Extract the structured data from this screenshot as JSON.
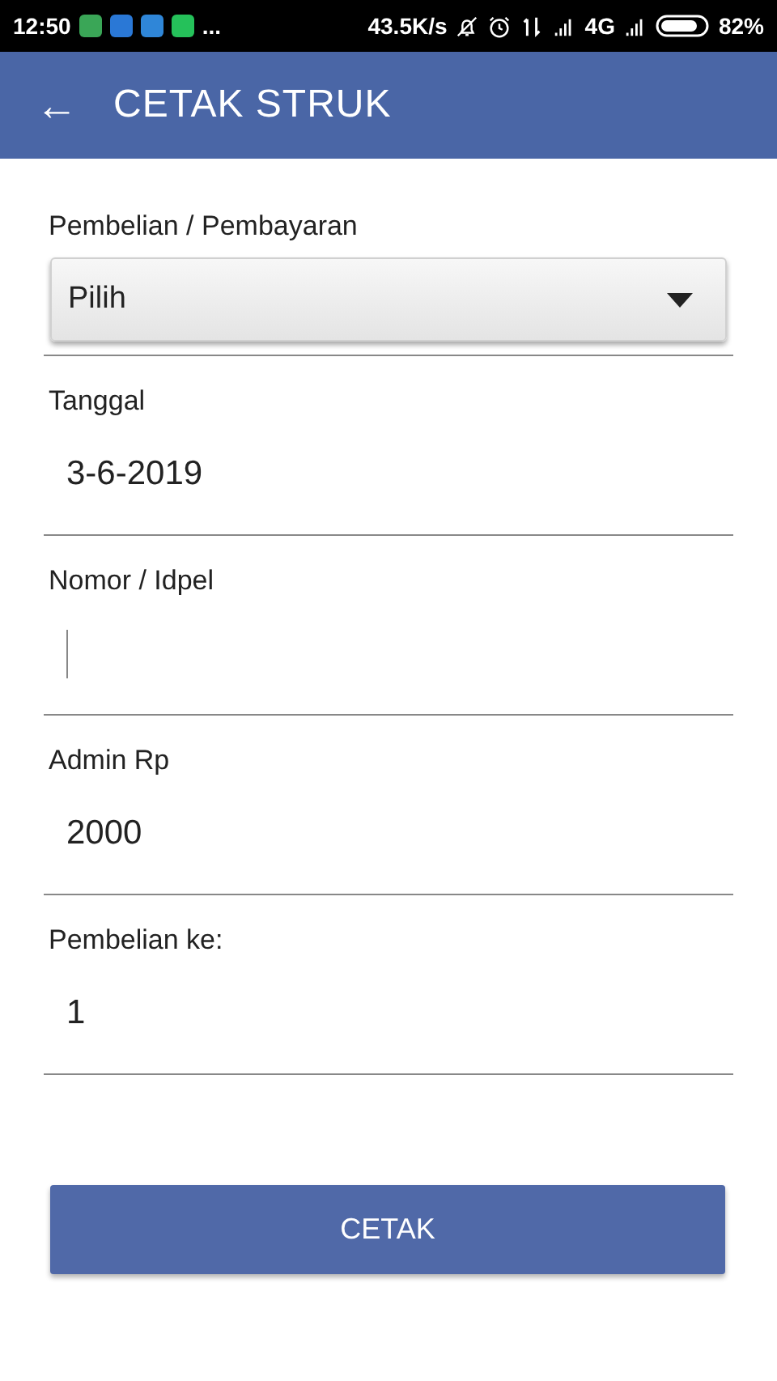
{
  "status_bar": {
    "time": "12:50",
    "more": "...",
    "speed": "43.5K/s",
    "network": "4G",
    "battery": "82%"
  },
  "app_bar": {
    "back": "←",
    "title": "CETAK STRUK"
  },
  "fields": [
    {
      "kind": "select",
      "label": "Pembelian / Pembayaran",
      "value": "Pilih"
    },
    {
      "kind": "text",
      "label": "Tanggal",
      "value": "3-6-2019",
      "focused": false
    },
    {
      "kind": "text",
      "label": "Nomor / Idpel",
      "focused": true
    },
    {
      "kind": "text",
      "label": "Admin Rp",
      "value": "2000",
      "focused": false
    },
    {
      "kind": "text",
      "label": "Pembelian ke:",
      "value": "1",
      "focused": false
    }
  ],
  "button": "CETAK"
}
